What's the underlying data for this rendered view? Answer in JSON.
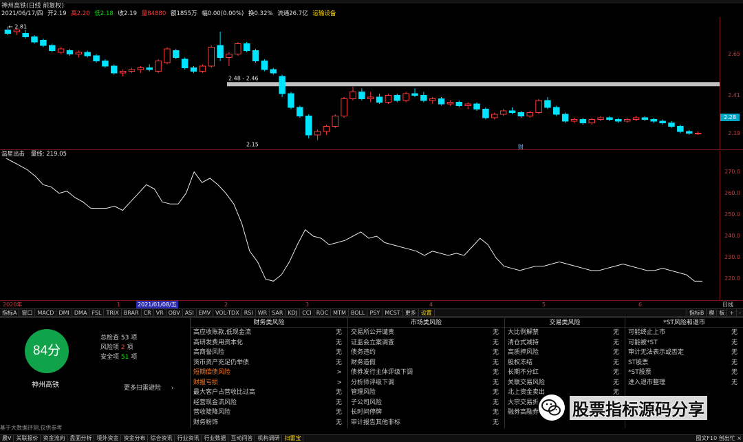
{
  "header": {
    "stock_title": "神州高铁(日线 前复权)",
    "quote": {
      "date": "2021/06/17/四",
      "open_label": "开",
      "open": "2.19",
      "high_label": "高",
      "high": "2.20",
      "low_label": "低",
      "low": "2.18",
      "close_label": "收",
      "close": "2.19",
      "volume": "量84880",
      "amount": "额1855万",
      "change": "幅0.00(0.00%)",
      "turnover": "换0.32%",
      "float_cap": "流通26.7亿",
      "signal": "运输设备"
    }
  },
  "price_chart": {
    "axis_ticks": [
      "2.65",
      "2.41",
      "2.28",
      "2.19"
    ],
    "current_price": "2.28",
    "annotations": {
      "high": "2.81",
      "low": "2.15",
      "line_label": "2.48 - 2.46",
      "marker": "财"
    },
    "candles": [
      {
        "o": 2.79,
        "h": 2.81,
        "l": 2.76,
        "c": 2.77
      },
      {
        "o": 2.78,
        "h": 2.8,
        "l": 2.76,
        "c": 2.79
      },
      {
        "o": 2.77,
        "h": 2.79,
        "l": 2.74,
        "c": 2.75
      },
      {
        "o": 2.75,
        "h": 2.76,
        "l": 2.71,
        "c": 2.72
      },
      {
        "o": 2.73,
        "h": 2.74,
        "l": 2.69,
        "c": 2.7
      },
      {
        "o": 2.7,
        "h": 2.71,
        "l": 2.66,
        "c": 2.67
      },
      {
        "o": 2.66,
        "h": 2.69,
        "l": 2.65,
        "c": 2.68
      },
      {
        "o": 2.67,
        "h": 2.68,
        "l": 2.64,
        "c": 2.65
      },
      {
        "o": 2.65,
        "h": 2.67,
        "l": 2.63,
        "c": 2.66
      },
      {
        "o": 2.66,
        "h": 2.67,
        "l": 2.63,
        "c": 2.64
      },
      {
        "o": 2.64,
        "h": 2.65,
        "l": 2.6,
        "c": 2.61
      },
      {
        "o": 2.61,
        "h": 2.62,
        "l": 2.57,
        "c": 2.58
      },
      {
        "o": 2.58,
        "h": 2.59,
        "l": 2.53,
        "c": 2.54
      },
      {
        "o": 2.54,
        "h": 2.56,
        "l": 2.52,
        "c": 2.55
      },
      {
        "o": 2.55,
        "h": 2.57,
        "l": 2.54,
        "c": 2.56
      },
      {
        "o": 2.56,
        "h": 2.58,
        "l": 2.54,
        "c": 2.57
      },
      {
        "o": 2.57,
        "h": 2.59,
        "l": 2.55,
        "c": 2.56
      },
      {
        "o": 2.55,
        "h": 2.62,
        "l": 2.54,
        "c": 2.61
      },
      {
        "o": 2.6,
        "h": 2.69,
        "l": 2.59,
        "c": 2.68
      },
      {
        "o": 2.67,
        "h": 2.68,
        "l": 2.62,
        "c": 2.63
      },
      {
        "o": 2.62,
        "h": 2.63,
        "l": 2.56,
        "c": 2.57
      },
      {
        "o": 2.57,
        "h": 2.58,
        "l": 2.54,
        "c": 2.55
      },
      {
        "o": 2.55,
        "h": 2.59,
        "l": 2.54,
        "c": 2.58
      },
      {
        "o": 2.58,
        "h": 2.7,
        "l": 2.57,
        "c": 2.69
      },
      {
        "o": 2.7,
        "h": 2.78,
        "l": 2.61,
        "c": 2.63
      },
      {
        "o": 2.63,
        "h": 2.66,
        "l": 2.58,
        "c": 2.65
      },
      {
        "o": 2.65,
        "h": 2.72,
        "l": 2.64,
        "c": 2.71
      },
      {
        "o": 2.71,
        "h": 2.72,
        "l": 2.66,
        "c": 2.67
      },
      {
        "o": 2.67,
        "h": 2.68,
        "l": 2.6,
        "c": 2.61
      },
      {
        "o": 2.61,
        "h": 2.62,
        "l": 2.55,
        "c": 2.56
      },
      {
        "o": 2.56,
        "h": 2.57,
        "l": 2.53,
        "c": 2.54
      },
      {
        "o": 2.52,
        "h": 2.53,
        "l": 2.4,
        "c": 2.42
      },
      {
        "o": 2.42,
        "h": 2.43,
        "l": 2.33,
        "c": 2.34
      },
      {
        "o": 2.34,
        "h": 2.35,
        "l": 2.28,
        "c": 2.29
      },
      {
        "o": 2.29,
        "h": 2.3,
        "l": 2.16,
        "c": 2.18
      },
      {
        "o": 2.18,
        "h": 2.21,
        "l": 2.15,
        "c": 2.2
      },
      {
        "o": 2.2,
        "h": 2.24,
        "l": 2.18,
        "c": 2.23
      },
      {
        "o": 2.23,
        "h": 2.3,
        "l": 2.22,
        "c": 2.29
      },
      {
        "o": 2.29,
        "h": 2.4,
        "l": 2.28,
        "c": 2.39
      },
      {
        "o": 2.39,
        "h": 2.46,
        "l": 2.38,
        "c": 2.43
      },
      {
        "o": 2.43,
        "h": 2.45,
        "l": 2.38,
        "c": 2.39
      },
      {
        "o": 2.39,
        "h": 2.43,
        "l": 2.37,
        "c": 2.4
      },
      {
        "o": 2.4,
        "h": 2.42,
        "l": 2.36,
        "c": 2.37
      },
      {
        "o": 2.37,
        "h": 2.42,
        "l": 2.36,
        "c": 2.41
      },
      {
        "o": 2.41,
        "h": 2.42,
        "l": 2.37,
        "c": 2.38
      },
      {
        "o": 2.38,
        "h": 2.43,
        "l": 2.37,
        "c": 2.42
      },
      {
        "o": 2.42,
        "h": 2.45,
        "l": 2.4,
        "c": 2.41
      },
      {
        "o": 2.41,
        "h": 2.43,
        "l": 2.37,
        "c": 2.38
      },
      {
        "o": 2.38,
        "h": 2.4,
        "l": 2.36,
        "c": 2.39
      },
      {
        "o": 2.39,
        "h": 2.4,
        "l": 2.35,
        "c": 2.36
      },
      {
        "o": 2.36,
        "h": 2.38,
        "l": 2.35,
        "c": 2.37
      },
      {
        "o": 2.37,
        "h": 2.38,
        "l": 2.34,
        "c": 2.35
      },
      {
        "o": 2.35,
        "h": 2.37,
        "l": 2.33,
        "c": 2.36
      },
      {
        "o": 2.36,
        "h": 2.37,
        "l": 2.32,
        "c": 2.33
      },
      {
        "o": 2.33,
        "h": 2.34,
        "l": 2.27,
        "c": 2.28
      },
      {
        "o": 2.28,
        "h": 2.31,
        "l": 2.27,
        "c": 2.3
      },
      {
        "o": 2.3,
        "h": 2.33,
        "l": 2.29,
        "c": 2.32
      },
      {
        "o": 2.32,
        "h": 2.34,
        "l": 2.3,
        "c": 2.31
      },
      {
        "o": 2.31,
        "h": 2.32,
        "l": 2.28,
        "c": 2.29
      },
      {
        "o": 2.29,
        "h": 2.32,
        "l": 2.28,
        "c": 2.31
      },
      {
        "o": 2.31,
        "h": 2.39,
        "l": 2.3,
        "c": 2.38
      },
      {
        "o": 2.38,
        "h": 2.4,
        "l": 2.33,
        "c": 2.34
      },
      {
        "o": 2.34,
        "h": 2.35,
        "l": 2.29,
        "c": 2.3
      },
      {
        "o": 2.3,
        "h": 2.31,
        "l": 2.25,
        "c": 2.26
      },
      {
        "o": 2.26,
        "h": 2.28,
        "l": 2.25,
        "c": 2.27
      },
      {
        "o": 2.27,
        "h": 2.28,
        "l": 2.24,
        "c": 2.25
      },
      {
        "o": 2.25,
        "h": 2.28,
        "l": 2.24,
        "c": 2.27
      },
      {
        "o": 2.27,
        "h": 2.29,
        "l": 2.26,
        "c": 2.28
      },
      {
        "o": 2.28,
        "h": 2.29,
        "l": 2.26,
        "c": 2.27
      },
      {
        "o": 2.27,
        "h": 2.28,
        "l": 2.25,
        "c": 2.26
      },
      {
        "o": 2.26,
        "h": 2.28,
        "l": 2.25,
        "c": 2.27
      },
      {
        "o": 2.27,
        "h": 2.29,
        "l": 2.26,
        "c": 2.28
      },
      {
        "o": 2.28,
        "h": 2.29,
        "l": 2.26,
        "c": 2.27
      },
      {
        "o": 2.27,
        "h": 2.28,
        "l": 2.25,
        "c": 2.26
      },
      {
        "o": 2.26,
        "h": 2.27,
        "l": 2.24,
        "c": 2.25
      },
      {
        "o": 2.25,
        "h": 2.26,
        "l": 2.22,
        "c": 2.23
      },
      {
        "o": 2.23,
        "h": 2.24,
        "l": 2.19,
        "c": 2.2
      },
      {
        "o": 2.2,
        "h": 2.21,
        "l": 2.18,
        "c": 2.19
      },
      {
        "o": 2.19,
        "h": 2.2,
        "l": 2.18,
        "c": 2.19
      }
    ],
    "ymin": 2.12,
    "ymax": 2.84,
    "hline": 2.475
  },
  "indicator": {
    "name": "温星出击",
    "value_label": "量线: 219.05",
    "axis_ticks": [
      "270.0",
      "260.0",
      "250.0",
      "240.0",
      "230.0",
      "220.0"
    ],
    "ymin": 214,
    "ymax": 275,
    "line": [
      277,
      275,
      273,
      271,
      268,
      264,
      263,
      260,
      261,
      258,
      256,
      253,
      253,
      253,
      254,
      252,
      256,
      260,
      264,
      262,
      256,
      255,
      255,
      260,
      270,
      265,
      267,
      264,
      260,
      255,
      246,
      233,
      228,
      220,
      219,
      222,
      228,
      236,
      243,
      240,
      239,
      236,
      237,
      238,
      240,
      242,
      239,
      240,
      237,
      236,
      235,
      234,
      233,
      231,
      233,
      232,
      231,
      232,
      231,
      235,
      239,
      236,
      230,
      226,
      225,
      224,
      225,
      226,
      226,
      227,
      228,
      227,
      226,
      225,
      224,
      224,
      225,
      226,
      227,
      226,
      225,
      224,
      224,
      225,
      224,
      223,
      222,
      219,
      219
    ]
  },
  "date_axis": {
    "labels": [
      "2020年",
      "1",
      "2021/01/08/五",
      "2",
      "3",
      "4",
      "5",
      "6"
    ],
    "unit": "日线"
  },
  "tabs": [
    "指标A",
    "窗口",
    "MACD",
    "DMI",
    "DMA",
    "FSL",
    "TRIX",
    "BRAR",
    "CR",
    "VR",
    "OBV",
    "ASI",
    "EMV",
    "VOL-TDX",
    "RSI",
    "WR",
    "SAR",
    "KDJ",
    "CCI",
    "ROC",
    "MTM",
    "BOLL",
    "PSY",
    "MCST",
    "更多",
    "设置"
  ],
  "tabs_right": [
    "指标B",
    "模",
    "板",
    "+",
    "-"
  ],
  "score": {
    "value": "84分",
    "stock_name": "神州高铁",
    "stats": [
      {
        "label": "总检查",
        "value": "53",
        "unit": "项"
      },
      {
        "label": "风险项",
        "value": "2",
        "unit": "项"
      },
      {
        "label": "安全项",
        "value": "51",
        "unit": "项"
      }
    ],
    "more": "更多扫雷避险",
    "footnote": "基于大数据评测,仅供参考"
  },
  "risk_columns": [
    {
      "title": "财务类风险",
      "items": [
        {
          "label": "高应收账款,低现金流",
          "status": "无"
        },
        {
          "label": "高研发费用资本化",
          "status": "无"
        },
        {
          "label": "高商誉风险",
          "status": "无"
        },
        {
          "label": "货币资产充足仍举债",
          "status": "无"
        },
        {
          "label": "短期偿债风险",
          "status": ">",
          "hit": true
        },
        {
          "label": "财报亏损",
          "status": ">",
          "hit": true
        },
        {
          "label": "最大客户占营收比过高",
          "status": "无"
        },
        {
          "label": "经营现金流风险",
          "status": "无"
        },
        {
          "label": "营收陡降风险",
          "status": "无"
        },
        {
          "label": "财务粉饰",
          "status": "无"
        }
      ]
    },
    {
      "title": "市场类风险",
      "items": [
        {
          "label": "交易所公开谴责",
          "status": "无"
        },
        {
          "label": "证监会立案调查",
          "status": "无"
        },
        {
          "label": "债务违约",
          "status": "无"
        },
        {
          "label": "财务造假",
          "status": "无"
        },
        {
          "label": "债券发行主体评级下调",
          "status": "无"
        },
        {
          "label": "分析师评级下调",
          "status": "无"
        },
        {
          "label": "管理风险",
          "status": "无"
        },
        {
          "label": "子公司风险",
          "status": "无"
        },
        {
          "label": "长时间停牌",
          "status": "无"
        },
        {
          "label": "审计报告其他非标",
          "status": "无"
        }
      ]
    },
    {
      "title": "交易类风险",
      "items": [
        {
          "label": "大比例解禁",
          "status": "无"
        },
        {
          "label": "清仓式减持",
          "status": "无"
        },
        {
          "label": "高质押风险",
          "status": "无"
        },
        {
          "label": "股权冻结",
          "status": "无"
        },
        {
          "label": "长期不分红",
          "status": "无"
        },
        {
          "label": "关联交易风险",
          "status": "无"
        },
        {
          "label": "北上资金卖出",
          "status": "无"
        },
        {
          "label": "大宗交易折",
          "status": "无"
        },
        {
          "label": "融券高融券",
          "status": "无"
        }
      ]
    },
    {
      "title": "*ST风险和退市",
      "items": [
        {
          "label": "可能终止上市",
          "status": "无"
        },
        {
          "label": "可能被*ST",
          "status": "无"
        },
        {
          "label": "审计无法表示或否定",
          "status": "无"
        },
        {
          "label": "ST股票",
          "status": "无"
        },
        {
          "label": "*ST股票",
          "status": "无"
        },
        {
          "label": "进入退市整理",
          "status": "无"
        }
      ]
    }
  ],
  "bottom_nav": [
    "晨V",
    "关联报价",
    "资金流向",
    "盘面分析",
    "境外资金",
    "资金分布",
    "综合资讯",
    "行业资讯",
    "行业数据",
    "互动问答",
    "机构调研",
    "扫雷宝"
  ],
  "bottom_right": "图文F10 创出忙 ×",
  "watermark": "股票指标源码分享",
  "colors": {
    "up": "#ff3c3c",
    "down": "#00e4ff",
    "score_green": "#11a34a",
    "axis": "#c04040",
    "hline": "#c0c0c0"
  }
}
